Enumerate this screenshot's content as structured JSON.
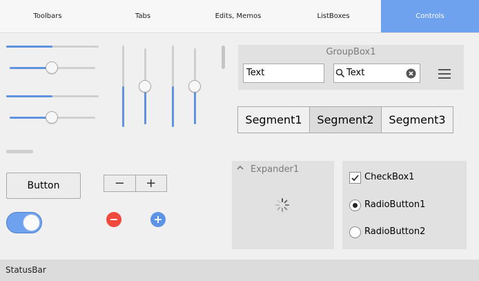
{
  "tabs": [
    {
      "label": "Toolbars",
      "active": false
    },
    {
      "label": "Tabs",
      "active": false
    },
    {
      "label": "Edits, Memos",
      "active": false
    },
    {
      "label": "ListBoxes",
      "active": false
    },
    {
      "label": "Controls",
      "active": true
    }
  ],
  "groupbox": {
    "title": "GroupBox1",
    "edit1_value": "Text",
    "search_value": "Text",
    "menu_icon": "hamburger-icon"
  },
  "segments": {
    "items": [
      "Segment1",
      "Segment2",
      "Segment3"
    ],
    "selected_index": 1
  },
  "controls": {
    "button_label": "Button",
    "spin_minus": "−",
    "spin_plus": "+",
    "remove_icon_glyph": "−",
    "add_icon_glyph": "+",
    "switch_on": true
  },
  "sliders": {
    "track1_progress": 0.5,
    "slider1_value": 0.5,
    "track2_progress": 0.5,
    "slider2_value": 0.5,
    "vtrack1_progress": 0.5,
    "vslider1_value": 0.5,
    "vtrack2_progress": 0.5,
    "vslider2_value": 0.5
  },
  "expander": {
    "title": "Expander1",
    "expanded": true
  },
  "options": {
    "checkbox_label": "CheckBox1",
    "checkbox_checked": true,
    "radio1_label": "RadioButton1",
    "radio1_checked": true,
    "radio2_label": "RadioButton2",
    "radio2_checked": false
  },
  "statusbar": {
    "text": "StatusBar"
  },
  "colors": {
    "accent": "#6fa2ee",
    "fill": "#5f93e0",
    "remove_red": "#f04a3e",
    "add_blue": "#5e92e6"
  }
}
